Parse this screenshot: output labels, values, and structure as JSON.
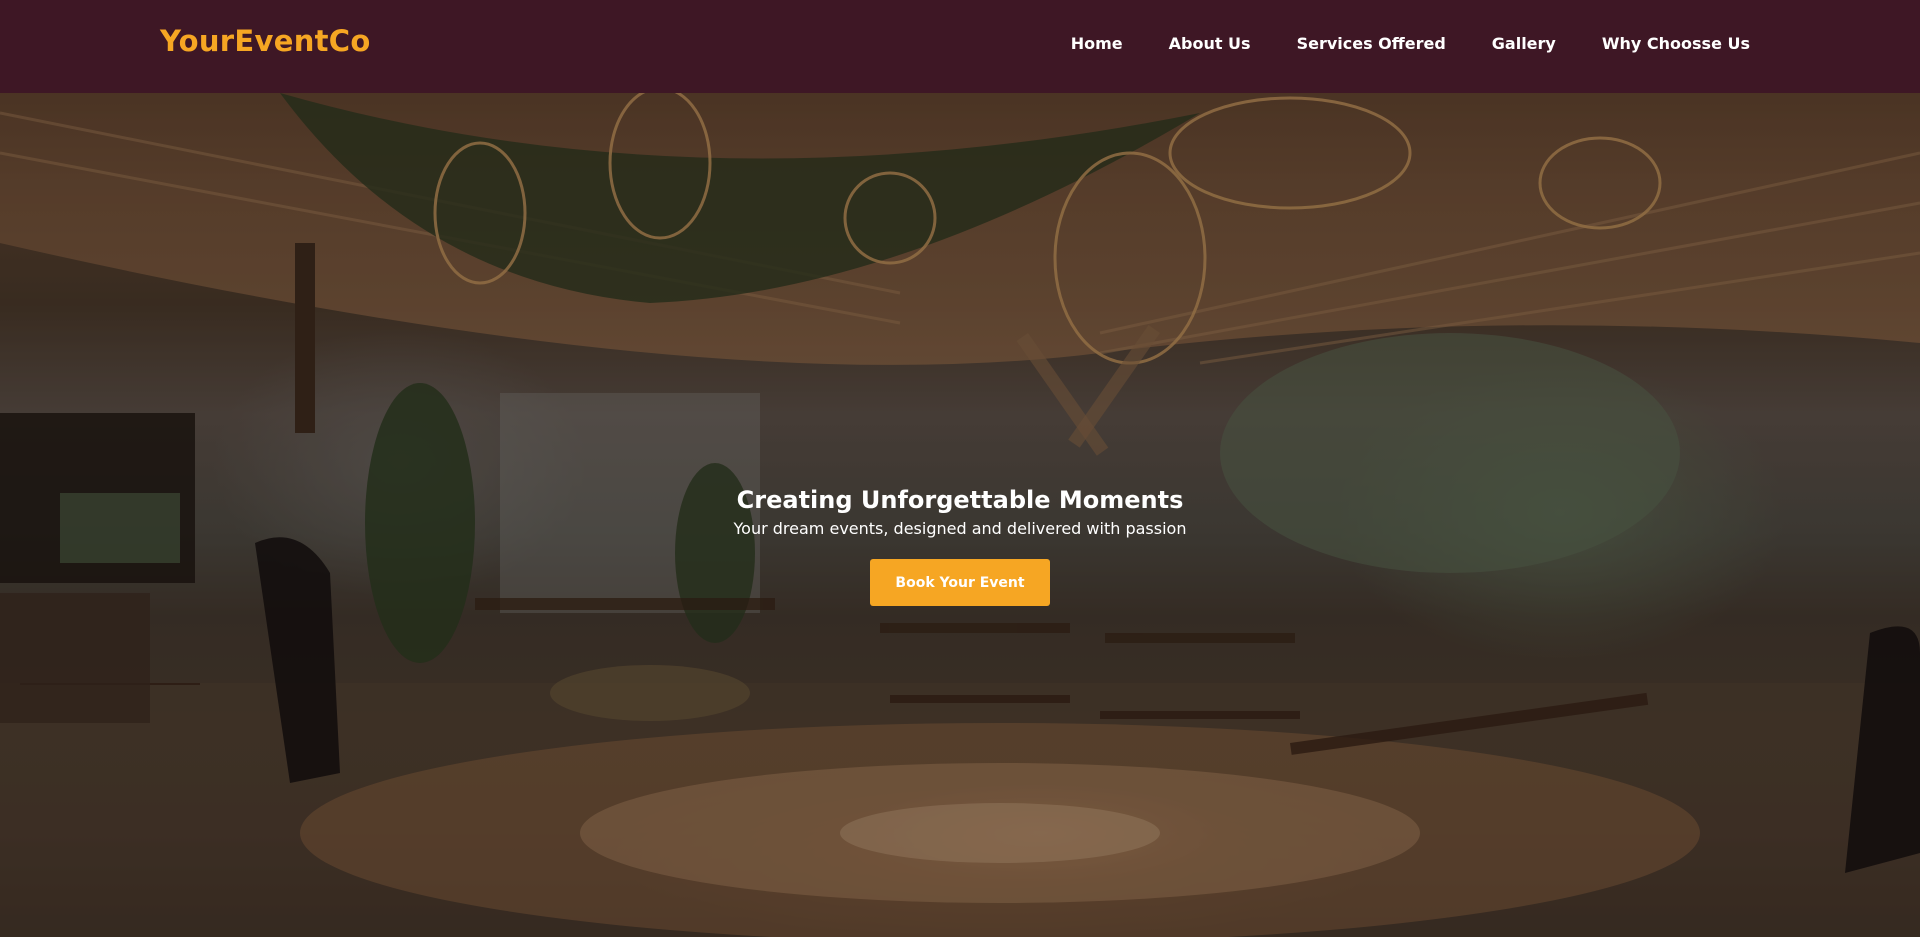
{
  "brand": {
    "name": "YourEventCo",
    "color": "#f6a623"
  },
  "nav": {
    "items": [
      {
        "label": "Home"
      },
      {
        "label": "About Us"
      },
      {
        "label": "Services Offered"
      },
      {
        "label": "Gallery"
      },
      {
        "label": "Why Choosse Us"
      }
    ],
    "background": "#3e1725"
  },
  "hero": {
    "title": "Creating Unforgettable Moments",
    "subtitle": "Your dream events, designed and delivered with passion",
    "cta_label": "Book Your Event",
    "cta_color": "#f6a623"
  }
}
